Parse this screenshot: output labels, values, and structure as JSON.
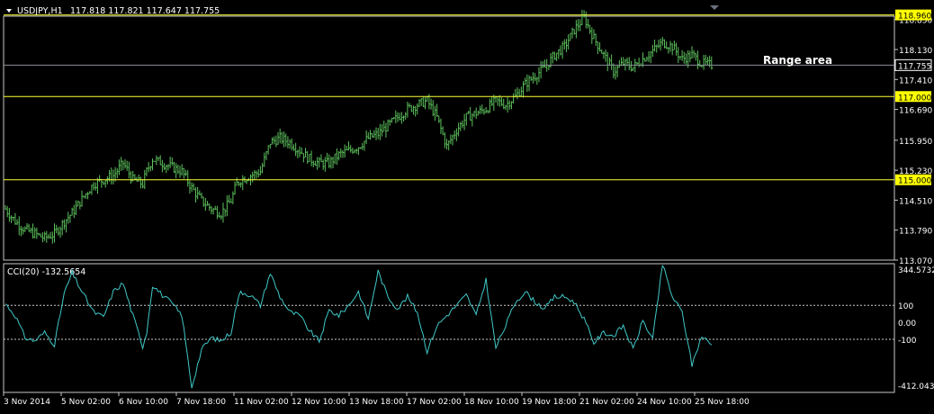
{
  "header": {
    "symbol": "USDJPY,H1",
    "ohlc": "117.818 117.821 117.647 117.755",
    "menu_icon": "triangle-down-icon"
  },
  "colors": {
    "background": "#000000",
    "frame": "#c8c8c8",
    "candles": "#5cc05c",
    "level_lines": "#ffff33",
    "level_label_bg": "#ffff00",
    "current_price_line": "#8a8f9a",
    "cci_line": "#40c8c8",
    "cci_levels": "#c8c8c8",
    "text": "#ffffff"
  },
  "annotation": {
    "text": "Range area"
  },
  "price_levels": [
    {
      "value": 118.96,
      "label": "118.960"
    },
    {
      "value": 117.0,
      "label": "117.000"
    },
    {
      "value": 115.0,
      "label": "115.000"
    }
  ],
  "current_price": {
    "value": 117.755,
    "label": "117.755"
  },
  "cci": {
    "title": "CCI(20) -132.5654",
    "levels": [
      {
        "value": 100,
        "label": "100"
      },
      {
        "value": -100,
        "label": "-100"
      }
    ],
    "zero_label": "0.00",
    "max_label": "344.5732",
    "min_label": "-412.0435"
  },
  "chart_data": [
    {
      "type": "candlestick",
      "title": "USDJPY,H1",
      "ylim": [
        113.07,
        118.93
      ],
      "y_ticks": [
        "118.850",
        "118.130",
        "117.410",
        "116.690",
        "115.950",
        "115.230",
        "114.510",
        "113.790",
        "113.070"
      ],
      "x_ticks": [
        "3 Nov 2014",
        "5 Nov 02:00",
        "6 Nov 10:00",
        "7 Nov 18:00",
        "11 Nov 02:00",
        "12 Nov 10:00",
        "13 Nov 18:00",
        "17 Nov 02:00",
        "18 Nov 10:00",
        "19 Nov 18:00",
        "21 Nov 02:00",
        "24 Nov 10:00",
        "25 Nov 18:00"
      ],
      "series_anchors": {
        "x_index": [
          0,
          5,
          10,
          15,
          20,
          25,
          30,
          34,
          40,
          45,
          50,
          55,
          60,
          65,
          70,
          72,
          75,
          80,
          85,
          90,
          95,
          100,
          105,
          110,
          115,
          118,
          120,
          125,
          130,
          135,
          140,
          145,
          150,
          155,
          160,
          165,
          170,
          175,
          180,
          185,
          190,
          195,
          200,
          205,
          210,
          215,
          220,
          225,
          230,
          235,
          240,
          245,
          250,
          255,
          260,
          265,
          270,
          275,
          280,
          285,
          290,
          295,
          300,
          305,
          310,
          315,
          320,
          325,
          330,
          335,
          340,
          345,
          350,
          355,
          360
        ],
        "close": [
          114.3,
          114.0,
          113.8,
          113.7,
          113.6,
          113.7,
          114.0,
          114.2,
          114.6,
          114.9,
          115.0,
          115.1,
          115.4,
          115.0,
          114.9,
          115.2,
          115.5,
          115.4,
          115.3,
          115.2,
          114.8,
          114.5,
          114.3,
          114.2,
          114.5,
          114.9,
          115.0,
          115.1,
          115.2,
          115.9,
          116.0,
          115.9,
          115.7,
          115.5,
          115.4,
          115.4,
          115.6,
          115.7,
          115.8,
          116.0,
          116.1,
          116.3,
          116.5,
          116.7,
          116.8,
          116.9,
          116.5,
          115.8,
          116.2,
          116.5,
          116.6,
          116.7,
          116.9,
          116.8,
          117.0,
          117.3,
          117.5,
          117.7,
          118.0,
          118.2,
          118.6,
          118.9,
          118.4,
          118.0,
          117.6,
          117.8,
          117.7,
          117.9,
          118.1,
          118.3,
          118.2,
          117.9,
          118.0,
          117.8,
          117.755
        ]
      },
      "bar_count": 361
    },
    {
      "type": "line",
      "title": "CCI(20) -132.5654",
      "ylim": [
        -412.0435,
        344.5732
      ],
      "levels": [
        100,
        -100
      ],
      "x_index": [
        0,
        5,
        10,
        15,
        20,
        25,
        30,
        34,
        40,
        45,
        50,
        55,
        60,
        65,
        70,
        72,
        75,
        80,
        85,
        90,
        95,
        100,
        105,
        110,
        115,
        118,
        120,
        125,
        130,
        135,
        140,
        145,
        150,
        155,
        160,
        165,
        170,
        175,
        180,
        185,
        190,
        195,
        200,
        205,
        210,
        215,
        220,
        225,
        230,
        235,
        240,
        245,
        250,
        255,
        260,
        265,
        270,
        275,
        280,
        285,
        290,
        295,
        300,
        305,
        310,
        315,
        320,
        325,
        330,
        335,
        340,
        345,
        350,
        355,
        360
      ],
      "values": [
        110,
        40,
        -90,
        -110,
        -60,
        -130,
        170,
        290,
        160,
        60,
        30,
        180,
        230,
        40,
        -140,
        -60,
        220,
        160,
        110,
        40,
        -380,
        -160,
        -90,
        -110,
        -60,
        110,
        180,
        160,
        100,
        290,
        150,
        60,
        40,
        -50,
        -110,
        70,
        40,
        100,
        180,
        20,
        300,
        150,
        80,
        150,
        60,
        -170,
        -20,
        40,
        100,
        160,
        40,
        250,
        -150,
        -20,
        120,
        180,
        120,
        80,
        150,
        150,
        120,
        20,
        -120,
        -60,
        -80,
        -20,
        -160,
        10,
        -100,
        340,
        150,
        60,
        -250,
        -80,
        -132.5654
      ]
    }
  ]
}
